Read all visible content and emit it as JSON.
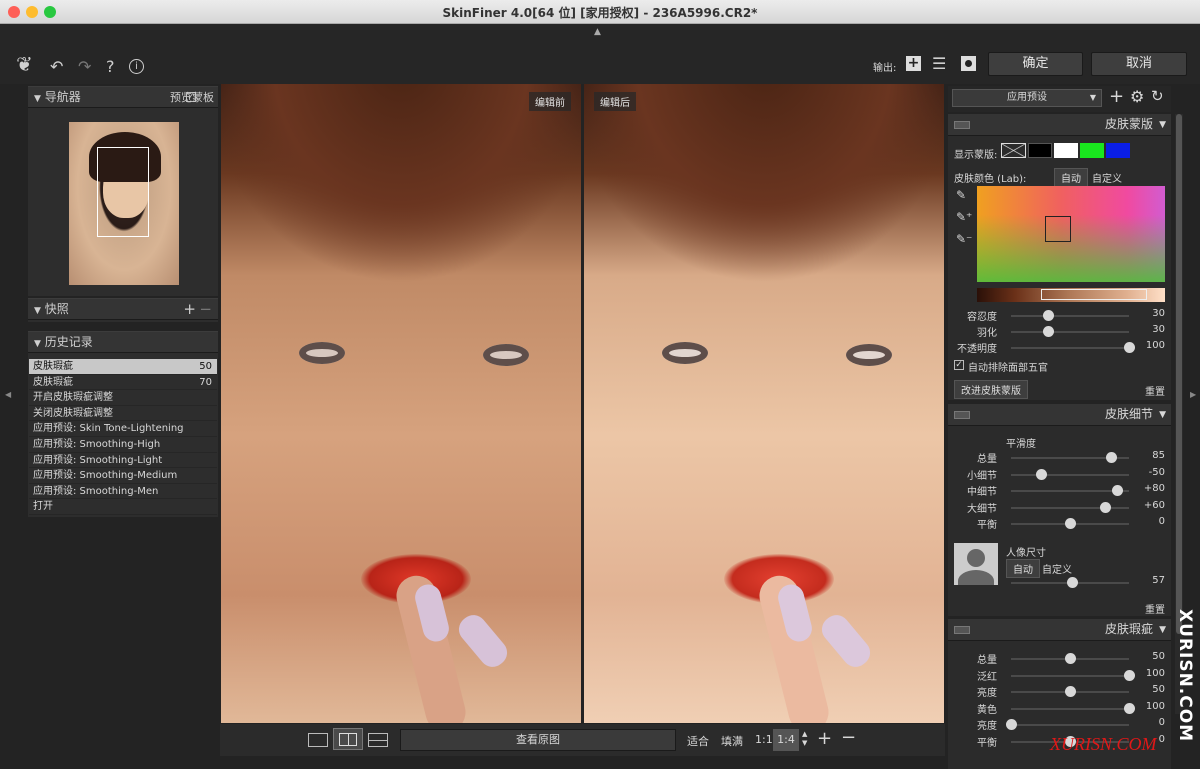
{
  "window": {
    "title": "SkinFiner 4.0[64 位] [家用授权] - 236A5996.CR2*"
  },
  "toolbar": {
    "output_label": "输出:",
    "confirm": "确定",
    "cancel": "取消"
  },
  "navigator": {
    "title": "导航器",
    "preview_mask": "预览蒙板"
  },
  "snapshot": {
    "title": "快照"
  },
  "history": {
    "title": "历史记录",
    "items": [
      {
        "label": "皮肤瑕疵",
        "value": "50"
      },
      {
        "label": "皮肤瑕疵",
        "value": "70"
      },
      {
        "label": "开启皮肤瑕疵调整",
        "value": ""
      },
      {
        "label": "关闭皮肤瑕疵调整",
        "value": ""
      },
      {
        "label": "应用预设: Skin Tone-Lightening",
        "value": ""
      },
      {
        "label": "应用预设: Smoothing-High",
        "value": ""
      },
      {
        "label": "应用预设: Smoothing-Light",
        "value": ""
      },
      {
        "label": "应用预设: Smoothing-Medium",
        "value": ""
      },
      {
        "label": "应用预设: Smoothing-Men",
        "value": ""
      },
      {
        "label": "打开",
        "value": ""
      }
    ]
  },
  "preview": {
    "before": "编辑前",
    "after": "编辑后"
  },
  "bottom": {
    "view_original": "查看原图",
    "fit": "适合",
    "fill": "填满",
    "ratio": "1:1",
    "zoom": "1:4"
  },
  "right": {
    "preset": "应用预设",
    "mask": {
      "title": "皮肤蒙版",
      "show_mask": "显示蒙版:",
      "skin_color": "皮肤颜色 (Lab):",
      "auto": "自动",
      "custom": "自定义",
      "sliders": [
        {
          "label": "容忍度",
          "value": "30",
          "pos": 0.31
        },
        {
          "label": "羽化",
          "value": "30",
          "pos": 0.31
        },
        {
          "label": "不透明度",
          "value": "100",
          "pos": 1.0
        }
      ],
      "auto_exclude": "自动排除面部五官",
      "improve": "改进皮肤蒙版",
      "reset": "重置"
    },
    "detail": {
      "title": "皮肤细节",
      "smooth": "平滑度",
      "sliders": [
        {
          "label": "总量",
          "value": "85",
          "pos": 0.85
        },
        {
          "label": "小细节",
          "value": "-50",
          "pos": 0.25
        },
        {
          "label": "中细节",
          "value": "+80",
          "pos": 0.9
        },
        {
          "label": "大细节",
          "value": "+60",
          "pos": 0.8
        },
        {
          "label": "平衡",
          "value": "0",
          "pos": 0.5
        }
      ],
      "portrait_size": "人像尺寸",
      "auto": "自动",
      "custom": "自定义",
      "size_value": "57",
      "reset": "重置"
    },
    "blemish": {
      "title": "皮肤瑕疵",
      "sliders": [
        {
          "label": "总量",
          "value": "50",
          "pos": 0.5
        },
        {
          "label": "泛红",
          "value": "100",
          "pos": 1.0
        },
        {
          "label": "亮度",
          "value": "50",
          "pos": 0.5
        },
        {
          "label": "黄色",
          "value": "100",
          "pos": 1.0
        },
        {
          "label": "亮度",
          "value": "0",
          "pos": 0.0
        },
        {
          "label": "平衡",
          "value": "0",
          "pos": 0.5
        }
      ]
    }
  },
  "watermark": {
    "side": "XURISN.COM",
    "corner": "XURISN.COM"
  },
  "colors": {
    "accent": "#c8c8c8",
    "bg": "#232323",
    "swatch_green": "#19e61e",
    "swatch_blue": "#0a1ee6"
  }
}
